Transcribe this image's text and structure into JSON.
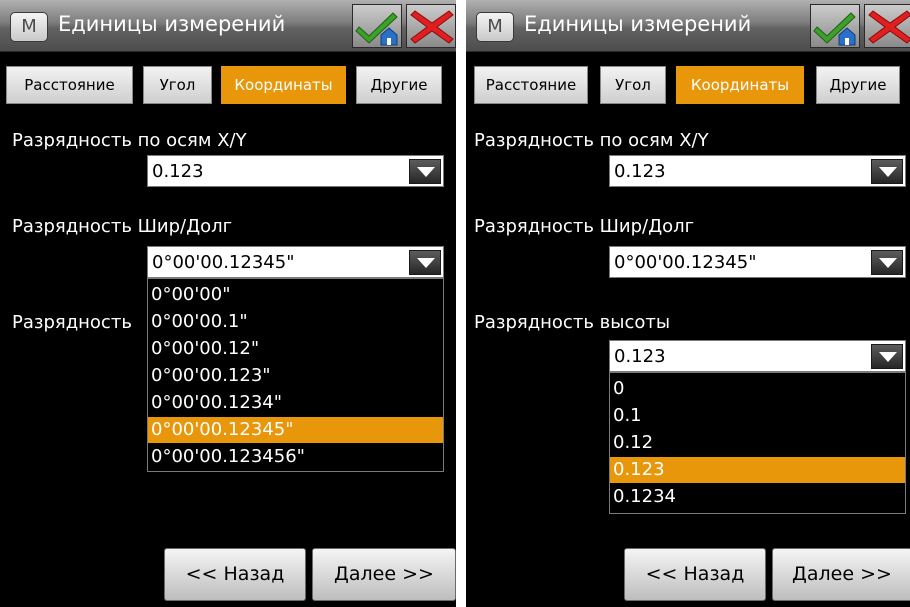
{
  "colors": {
    "accent": "#e8960a",
    "background": "#000000",
    "text": "#ffffff"
  },
  "left": {
    "app_icon_letter": "M",
    "title": "Единицы измерений",
    "tabs": [
      "Расстояние",
      "Угол",
      "Координаты",
      "Другие"
    ],
    "active_tab": "Координаты",
    "xy_label": "Разрядность по осям X/Y",
    "xy_value": "0.123",
    "latlon_label": "Разрядность Шир/Долг",
    "latlon_value": "0°00'00.12345\"",
    "height_label_partial": "Разрядность",
    "latlon_options": [
      "0°00'00\"",
      "0°00'00.1\"",
      "0°00'00.12\"",
      "0°00'00.123\"",
      "0°00'00.1234\"",
      "0°00'00.12345\"",
      "0°00'00.123456\""
    ],
    "latlon_selected_option": "0°00'00.12345\"",
    "back_label": "<< Назад",
    "next_label": "Далее >>"
  },
  "right": {
    "app_icon_letter": "M",
    "title": "Единицы измерений",
    "tabs": [
      "Расстояние",
      "Угол",
      "Координаты",
      "Другие"
    ],
    "active_tab": "Координаты",
    "xy_label": "Разрядность по осям X/Y",
    "xy_value": "0.123",
    "latlon_label": "Разрядность Шир/Долг",
    "latlon_value": "0°00'00.12345\"",
    "height_label": "Разрядность высоты",
    "height_value": "0.123",
    "height_options": [
      "0",
      "0.1",
      "0.12",
      "0.123",
      "0.1234"
    ],
    "height_selected_option": "0.123",
    "back_label": "<< Назад",
    "next_label": "Далее >>"
  },
  "icons": {
    "ok": "checkmark-home-icon",
    "cancel": "red-x-icon",
    "dropdown": "triangle-down-icon"
  }
}
